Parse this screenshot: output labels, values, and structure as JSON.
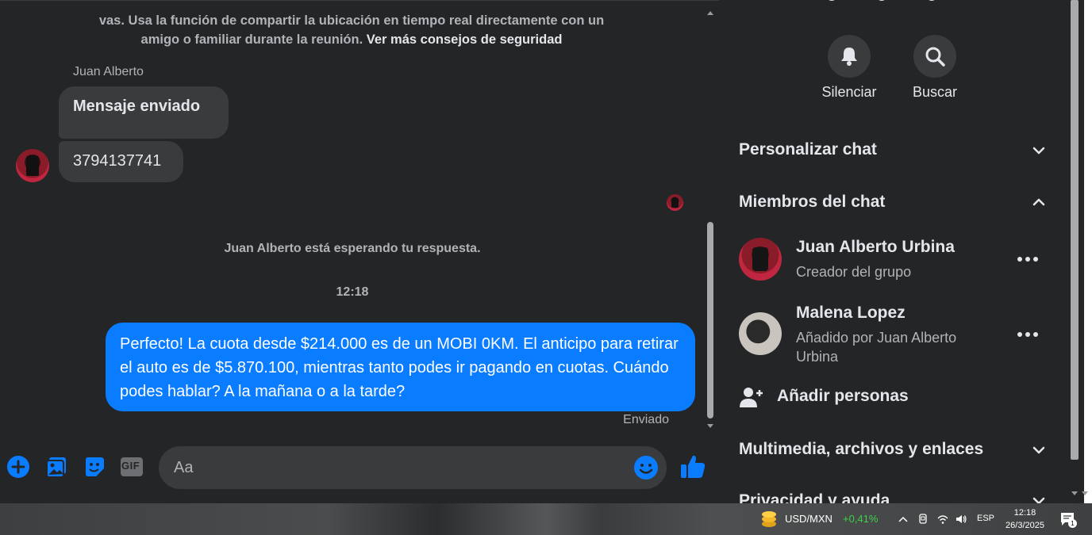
{
  "chat": {
    "safety_text": "vas. Usa la función de compartir la ubicación en tiempo real directamente con un amigo o familiar durante la reunión.",
    "safety_link": "Ver más consejos de seguridad",
    "sender_name": "Juan Alberto",
    "messages_in": [
      "Mensaje enviado",
      "3794137741"
    ],
    "waiting_text": "Juan Alberto está esperando tu respuesta.",
    "time": "12:18",
    "message_out": "Perfecto! La cuota desde $214.000 es de un MOBI 0KM. El anticipo para retirar el auto es de $5.870.100, mientras tanto podes ir pagando en cuotas. Cuándo podes hablar? A la mañana o a la tarde?",
    "sent_status": "Enviado"
  },
  "composer": {
    "placeholder": "Aa",
    "icons": [
      "plus-icon",
      "image-icon",
      "sticker-icon",
      "gif-icon",
      "emoji-icon",
      "like-icon"
    ],
    "gif_label": "GIF"
  },
  "panel": {
    "mute_label": "Silenciar",
    "search_label": "Buscar",
    "customize_chat": "Personalizar chat",
    "chat_members": "Miembros del chat",
    "members": [
      {
        "name": "Juan Alberto Urbina",
        "sub": "Creador del grupo"
      },
      {
        "name": "Malena Lopez",
        "sub": "Añadido por Juan Alberto Urbina"
      }
    ],
    "add_people": "Añadir personas",
    "media": "Multimedia, archivos y enlaces",
    "privacy": "Privacidad y ayuda"
  },
  "taskbar": {
    "pair": "USD/MXN",
    "change": "+0,41%",
    "lang": "ESP",
    "time": "12:18",
    "date": "26/3/2025",
    "notif_count": "1"
  },
  "colors": {
    "accent": "#0a7cff",
    "background": "#242526",
    "bubble_in": "#3a3b3c",
    "positive": "#3fd14b"
  }
}
